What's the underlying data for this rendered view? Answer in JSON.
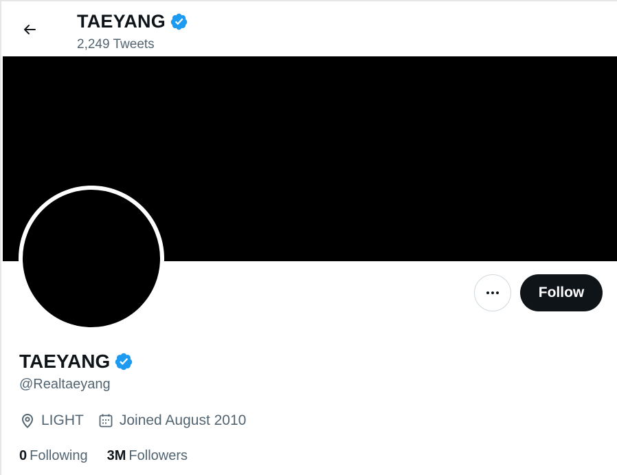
{
  "header": {
    "name": "TAEYANG",
    "tweets_count": "2,249 Tweets",
    "back_icon": "arrow-left-icon",
    "verified_icon": "verified-badge-icon"
  },
  "profile": {
    "name": "TAEYANG",
    "handle": "@Realtaeyang",
    "location": "LIGHT",
    "joined": "Joined August 2010",
    "location_icon": "location-pin-icon",
    "joined_icon": "calendar-icon"
  },
  "actions": {
    "more_icon": "more-horizontal-icon",
    "follow_label": "Follow"
  },
  "stats": {
    "following_count": "0",
    "following_label": "Following",
    "followers_count": "3M",
    "followers_label": "Followers"
  },
  "colors": {
    "verified": "#1d9bf0",
    "text_primary": "#0f1419",
    "text_secondary": "#536471",
    "banner": "#000000",
    "follow_button": "#0f1419"
  }
}
